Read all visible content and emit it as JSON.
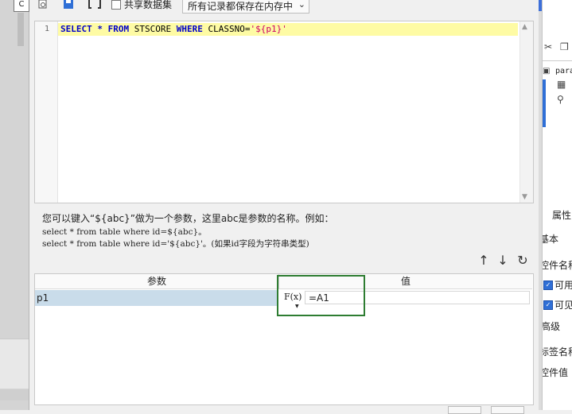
{
  "toolbar": {
    "share_dataset_label": "共享数据集",
    "memory_mode_value": "所有记录都保存在内存中"
  },
  "editor": {
    "line_number": "1",
    "sql_keyword_select": "SELECT",
    "sql_star": " * ",
    "sql_keyword_from": "FROM",
    "sql_table": " STSCORE ",
    "sql_keyword_where": "WHERE",
    "sql_condition": " CLASSNO=",
    "sql_string": "'${p1}'"
  },
  "hint": {
    "line1": "您可以键入“${abc}”做为一个参数，这里abc是参数的名称。例如：",
    "line2": "select * from table where id=${abc}。",
    "line3": "select * from table where id='${abc}'。(如果id字段为字符串类型)"
  },
  "param_table": {
    "columns": [
      "参数",
      "值"
    ],
    "rows": [
      {
        "name": "p1",
        "value": "=A1"
      }
    ],
    "fx_label": "F(x)"
  },
  "right_panel": {
    "para_label": "para",
    "properties_tab": "属性",
    "basic_section": "基本",
    "control_name": "控件名称",
    "enabled": "可用",
    "visible": "可见",
    "advanced_section": "高级",
    "tag_name": "标签名称",
    "control_value": "控件值"
  },
  "colors": {
    "highlight_line": "#fefba4",
    "selected_row": "#c9dcea",
    "annotation_box": "#2e7d32",
    "keyword": "#0000c8",
    "string": "#cc0066"
  }
}
